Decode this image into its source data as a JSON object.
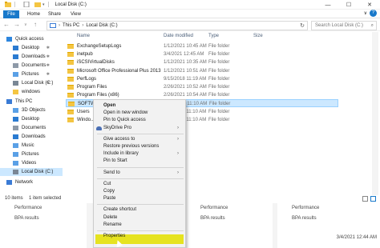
{
  "window": {
    "title": "Local Disk (C:)",
    "controls": [
      "—",
      "☐",
      "✕"
    ]
  },
  "ribbon": {
    "tabs": [
      "File",
      "Home",
      "Share",
      "View"
    ],
    "expand": "∨",
    "help": "?"
  },
  "address": {
    "crumbs": [
      "This PC",
      "Local Disk (C:)"
    ],
    "search_placeholder": "Search Local Disk (C:)"
  },
  "nav_pane": [
    {
      "label": "Quick access",
      "indent": 0,
      "pinned": false,
      "selected": false,
      "color": "#2e86de"
    },
    {
      "label": "Desktop",
      "indent": 1,
      "pinned": true,
      "selected": false,
      "color": "#2b7bd1"
    },
    {
      "label": "Downloads",
      "indent": 1,
      "pinned": true,
      "selected": false,
      "color": "#2b7bd1"
    },
    {
      "label": "Documents",
      "indent": 1,
      "pinned": true,
      "selected": false,
      "color": "#8e9aa8"
    },
    {
      "label": "Pictures",
      "indent": 1,
      "pinned": true,
      "selected": false,
      "color": "#5aa0e6"
    },
    {
      "label": "Local Disk (C:)",
      "indent": 1,
      "pinned": true,
      "selected": false,
      "color": "#7a8795"
    },
    {
      "label": "windows",
      "indent": 1,
      "pinned": false,
      "selected": false,
      "color": "#f4c542"
    },
    {
      "label": "This PC",
      "indent": 0,
      "pinned": false,
      "selected": false,
      "color": "#3a7bd5"
    },
    {
      "label": "3D Objects",
      "indent": 1,
      "pinned": false,
      "selected": false,
      "color": "#5aa0e6"
    },
    {
      "label": "Desktop",
      "indent": 1,
      "pinned": false,
      "selected": false,
      "color": "#2b7bd1"
    },
    {
      "label": "Documents",
      "indent": 1,
      "pinned": false,
      "selected": false,
      "color": "#8e9aa8"
    },
    {
      "label": "Downloads",
      "indent": 1,
      "pinned": false,
      "selected": false,
      "color": "#2b7bd1"
    },
    {
      "label": "Music",
      "indent": 1,
      "pinned": false,
      "selected": false,
      "color": "#5aa0e6"
    },
    {
      "label": "Pictures",
      "indent": 1,
      "pinned": false,
      "selected": false,
      "color": "#5aa0e6"
    },
    {
      "label": "Videos",
      "indent": 1,
      "pinned": false,
      "selected": false,
      "color": "#5aa0e6"
    },
    {
      "label": "Local Disk (C:)",
      "indent": 1,
      "pinned": false,
      "selected": true,
      "color": "#7a8795"
    },
    {
      "label": "Network",
      "indent": 0,
      "pinned": false,
      "selected": false,
      "color": "#3a7bd5"
    }
  ],
  "columns": {
    "name": "Name",
    "date": "Date modified",
    "type": "Type",
    "size": "Size"
  },
  "files": [
    {
      "name": "ExchangeSetupLogs",
      "date": "1/12/2021 10:45 AM",
      "type": "File folder",
      "selected": false
    },
    {
      "name": "inetpub",
      "date": "3/4/2021 12:45 AM",
      "type": "File folder",
      "selected": false
    },
    {
      "name": "iSCSIVirtualDisks",
      "date": "1/12/2021 10:35 AM",
      "type": "File folder",
      "selected": false
    },
    {
      "name": "Microsoft Office Professional Plus 2013",
      "date": "1/12/2021 10:51 AM",
      "type": "File folder",
      "selected": false
    },
    {
      "name": "PerfLogs",
      "date": "9/15/2018 11:19 AM",
      "type": "File folder",
      "selected": false
    },
    {
      "name": "Program Files",
      "date": "2/26/2021 10:52 AM",
      "type": "File folder",
      "selected": false
    },
    {
      "name": "Program Files (x86)",
      "date": "2/26/2021 10:54 AM",
      "type": "File folder",
      "selected": false
    },
    {
      "name": "SOFTW...",
      "date": "1/12/2021 11:10 AM",
      "type": "File folder",
      "selected": true
    },
    {
      "name": "Users",
      "date": "1/12/2021 11:10 AM",
      "type": "File folder",
      "selected": false
    },
    {
      "name": "Windo...",
      "date": "1/12/2021 11:10 AM",
      "type": "File folder",
      "selected": false
    }
  ],
  "status": {
    "items": "10 items",
    "selected": "1 item selected"
  },
  "dashboard": [
    {
      "line1": "Performance",
      "line2": "BPA results",
      "timestamp": ""
    },
    {
      "line1": "Performance",
      "line2": "BPA results",
      "timestamp": ""
    },
    {
      "line1": "Performance",
      "line2": "BPA results",
      "timestamp": "3/4/2021 12:44 AM"
    }
  ],
  "context_menu": [
    {
      "label": "Open",
      "bold": true,
      "submenu": false,
      "icon": ""
    },
    {
      "label": "Open in new window",
      "bold": false,
      "submenu": false,
      "icon": ""
    },
    {
      "label": "Pin to Quick access",
      "bold": false,
      "submenu": false,
      "icon": ""
    },
    {
      "label": "SkyDrive Pro",
      "bold": false,
      "submenu": true,
      "icon": "skydrive-icon"
    },
    {
      "divider": true
    },
    {
      "label": "Give access to",
      "bold": false,
      "submenu": true,
      "icon": ""
    },
    {
      "label": "Restore previous versions",
      "bold": false,
      "submenu": false,
      "icon": ""
    },
    {
      "label": "Include in library",
      "bold": false,
      "submenu": true,
      "icon": ""
    },
    {
      "label": "Pin to Start",
      "bold": false,
      "submenu": false,
      "icon": ""
    },
    {
      "divider": true
    },
    {
      "label": "Send to",
      "bold": false,
      "submenu": true,
      "icon": ""
    },
    {
      "divider": true
    },
    {
      "label": "Cut",
      "bold": false,
      "submenu": false,
      "icon": ""
    },
    {
      "label": "Copy",
      "bold": false,
      "submenu": false,
      "icon": ""
    },
    {
      "label": "Paste",
      "bold": false,
      "submenu": false,
      "icon": ""
    },
    {
      "divider": true
    },
    {
      "label": "Create shortcut",
      "bold": false,
      "submenu": false,
      "icon": ""
    },
    {
      "label": "Delete",
      "bold": false,
      "submenu": false,
      "icon": ""
    },
    {
      "label": "Rename",
      "bold": false,
      "submenu": false,
      "icon": ""
    },
    {
      "divider": true
    },
    {
      "label": "Properties",
      "bold": false,
      "submenu": false,
      "icon": "",
      "highlighted": true
    }
  ],
  "colors": {
    "accent": "#1979ca",
    "selection": "#cce8ff",
    "folder": "#f4c542",
    "highlight": "#e6e320"
  }
}
